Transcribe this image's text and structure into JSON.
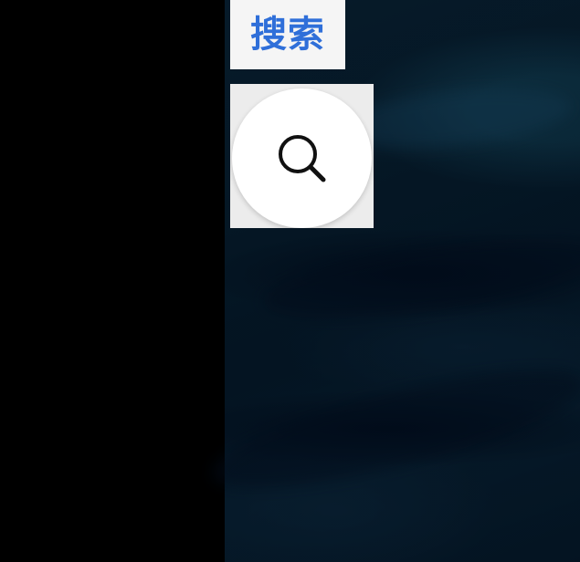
{
  "search_label": "搜索",
  "search_icon": "search-icon",
  "colors": {
    "label_text": "#2f6fd9",
    "label_bg": "#f5f5f5",
    "icon_bg": "#ffffff",
    "wallpaper": "#0b2a3a"
  }
}
